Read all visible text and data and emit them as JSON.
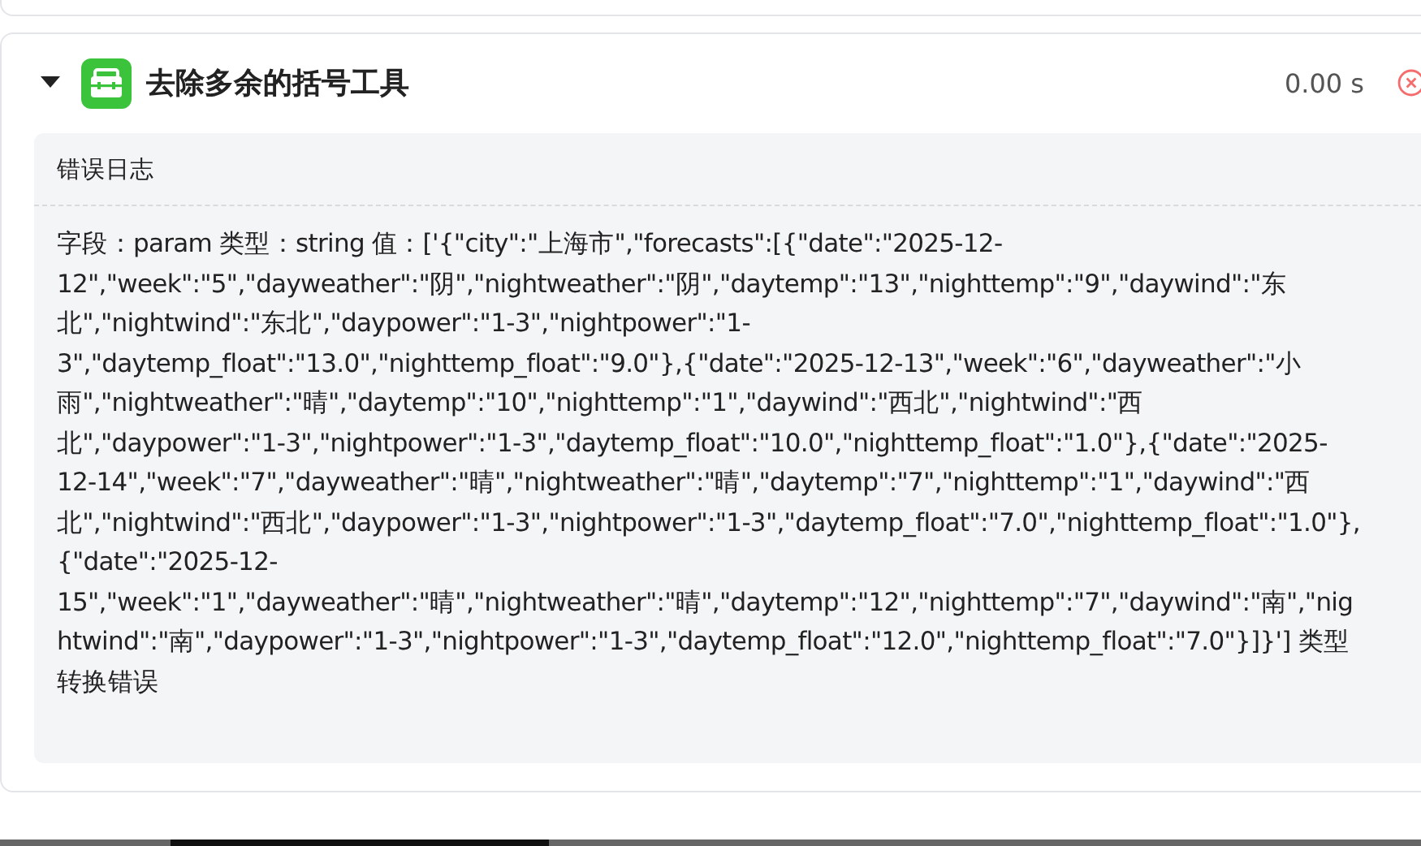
{
  "tool_card": {
    "expanded": true,
    "title": "去除多余的括号工具",
    "duration": "0.00 s",
    "failed": true,
    "log": {
      "heading": "错误日志",
      "message": "字段：param 类型：string 值：['{\"city\":\"上海市\",\"forecasts\":[{\"date\":\"2025-12-12\",\"week\":\"5\",\"dayweather\":\"阴\",\"nightweather\":\"阴\",\"daytemp\":\"13\",\"nighttemp\":\"9\",\"daywind\":\"东北\",\"nightwind\":\"东北\",\"daypower\":\"1-3\",\"nightpower\":\"1-3\",\"daytemp_float\":\"13.0\",\"nighttemp_float\":\"9.0\"},{\"date\":\"2025-12-13\",\"week\":\"6\",\"dayweather\":\"小雨\",\"nightweather\":\"晴\",\"daytemp\":\"10\",\"nighttemp\":\"1\",\"daywind\":\"西北\",\"nightwind\":\"西北\",\"daypower\":\"1-3\",\"nightpower\":\"1-3\",\"daytemp_float\":\"10.0\",\"nighttemp_float\":\"1.0\"},{\"date\":\"2025-12-14\",\"week\":\"7\",\"dayweather\":\"晴\",\"nightweather\":\"晴\",\"daytemp\":\"7\",\"nighttemp\":\"1\",\"daywind\":\"西北\",\"nightwind\":\"西北\",\"daypower\":\"1-3\",\"nightpower\":\"1-3\",\"daytemp_float\":\"7.0\",\"nighttemp_float\":\"1.0\"},{\"date\":\"2025-12-15\",\"week\":\"1\",\"dayweather\":\"晴\",\"nightweather\":\"晴\",\"daytemp\":\"12\",\"nighttemp\":\"7\",\"daywind\":\"南\",\"nightwind\":\"南\",\"daypower\":\"1-3\",\"nightpower\":\"1-3\",\"daytemp_float\":\"12.0\",\"nighttemp_float\":\"7.0\"}]}'] 类型转换错误"
    }
  }
}
